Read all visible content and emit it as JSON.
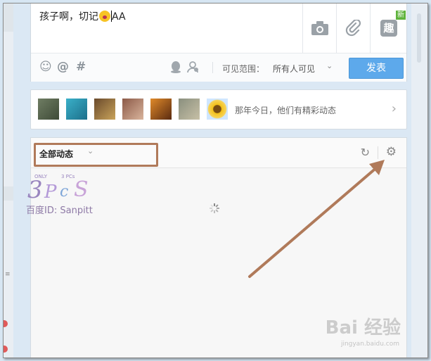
{
  "composer": {
    "text_before": "孩子啊，切记",
    "text_after": "AA",
    "new_badge": "新",
    "fun_icon_label": "趣",
    "visibility_label": "可见范围：",
    "visibility_value": "所有人可见",
    "post_button": "发表"
  },
  "memory_bar": {
    "text": "那年今日，他们有精彩动态"
  },
  "feed": {
    "filter_label": "全部动态"
  },
  "watermark": {
    "logo_text": "3PcS",
    "logo_small_left": "ONLY",
    "logo_small_right": "3 PCs",
    "id_text": "百度ID: Sanpitt",
    "baidu_text": "Bai 经验",
    "baidu_url": "jingyan.baidu.com"
  },
  "colors": {
    "post_button": "#5da9eb",
    "highlight_box": "#b07a5a",
    "arrow": "#b07a5a",
    "new_badge": "#5fb33d"
  },
  "icons": [
    "camera-icon",
    "link-icon",
    "emoji-icon",
    "at-icon",
    "hashtag-icon",
    "qq-icon",
    "mention-friend-icon",
    "refresh-icon",
    "gear-icon",
    "chevron-right-icon",
    "chevron-down-icon",
    "loading-spinner-icon"
  ]
}
